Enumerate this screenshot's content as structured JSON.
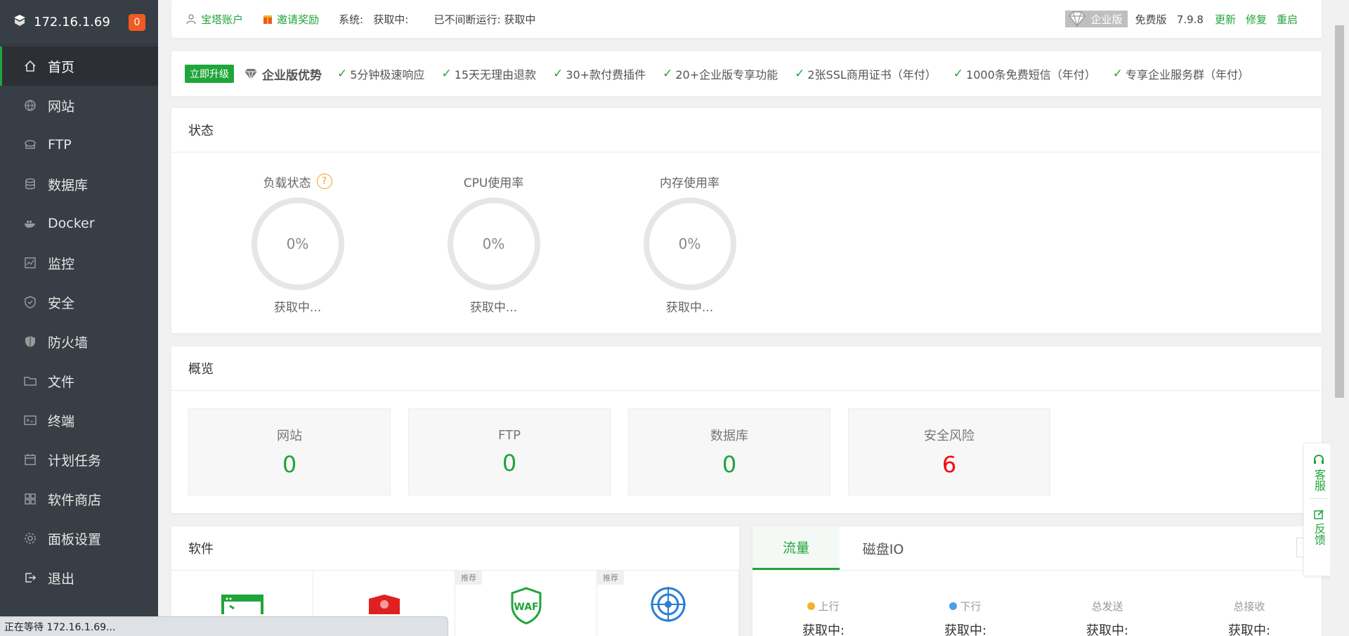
{
  "sidebar": {
    "ip": "172.16.1.69",
    "badge": "0",
    "items": [
      {
        "label": "首页",
        "icon": "home-icon"
      },
      {
        "label": "网站",
        "icon": "globe-icon"
      },
      {
        "label": "FTP",
        "icon": "ftp-icon"
      },
      {
        "label": "数据库",
        "icon": "database-icon"
      },
      {
        "label": "Docker",
        "icon": "docker-icon"
      },
      {
        "label": "监控",
        "icon": "monitor-icon"
      },
      {
        "label": "安全",
        "icon": "shield-check-icon"
      },
      {
        "label": "防火墙",
        "icon": "firewall-icon"
      },
      {
        "label": "文件",
        "icon": "folder-icon"
      },
      {
        "label": "终端",
        "icon": "terminal-icon"
      },
      {
        "label": "计划任务",
        "icon": "calendar-icon"
      },
      {
        "label": "软件商店",
        "icon": "apps-grid-icon"
      },
      {
        "label": "面板设置",
        "icon": "gear-icon"
      },
      {
        "label": "退出",
        "icon": "logout-icon"
      }
    ]
  },
  "topbar": {
    "account": "宝塔账户",
    "invite": "邀请奖励",
    "system_label": "系统:",
    "system_value": "获取中:",
    "uptime_label": "已不间断运行:",
    "uptime_value": "获取中",
    "enterprise": "企业版",
    "free": "免费版",
    "version": "7.9.8",
    "update": "更新",
    "repair": "修复",
    "restart": "重启"
  },
  "promo": {
    "upgrade": "立即升级",
    "advantage": "企业版优势",
    "features": [
      "5分钟极速响应",
      "15天无理由退款",
      "30+款付费插件",
      "20+企业版专享功能",
      "2张SSL商用证书（年付）",
      "1000条免费短信（年付）",
      "专享企业服务群（年付）"
    ]
  },
  "status": {
    "title": "状态",
    "gauges": [
      {
        "title": "负载状态",
        "value": "0%",
        "sub": "获取中..."
      },
      {
        "title": "CPU使用率",
        "value": "0%",
        "sub": "获取中..."
      },
      {
        "title": "内存使用率",
        "value": "0%",
        "sub": "获取中..."
      }
    ]
  },
  "overview": {
    "title": "概览",
    "items": [
      {
        "label": "网站",
        "value": "0"
      },
      {
        "label": "FTP",
        "value": "0"
      },
      {
        "label": "数据库",
        "value": "0"
      },
      {
        "label": "安全风险",
        "value": "6"
      }
    ]
  },
  "software": {
    "title": "软件",
    "rec_label": "推荐",
    "waf_label": "WAF"
  },
  "traffic": {
    "tabs": [
      "流量",
      "磁盘IO"
    ],
    "stats": [
      {
        "label": "上行",
        "value": "获取中:",
        "dot": "#f0b429"
      },
      {
        "label": "下行",
        "value": "获取中:",
        "dot": "#4a9fe8"
      },
      {
        "label": "总发送",
        "value": "获取中:"
      },
      {
        "label": "总接收",
        "value": "获取中:"
      }
    ]
  },
  "float": {
    "service": "客服",
    "feedback": "反馈"
  },
  "statusbar": {
    "text": "正在等待 172.16.1.69..."
  },
  "colors": {
    "accent": "#20a53a",
    "sidebar": "#383e45",
    "risk": "#ff0000",
    "badge": "#f15a22"
  }
}
